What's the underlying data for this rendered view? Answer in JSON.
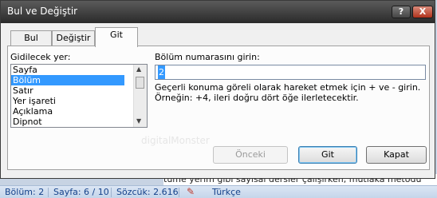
{
  "dialog": {
    "title": "Bul ve Değiştir",
    "help_label": "?",
    "close_label": "X",
    "tabs": [
      {
        "label": "Bul"
      },
      {
        "label": "Değiştir"
      },
      {
        "label": "Git",
        "active": true
      }
    ],
    "goto_label": "Gidilecek yer:",
    "goto_items": [
      {
        "label": "Sayfa"
      },
      {
        "label": "Bölüm",
        "selected": true
      },
      {
        "label": "Satır"
      },
      {
        "label": "Yer işareti"
      },
      {
        "label": "Açıklama"
      },
      {
        "label": "Dipnot"
      }
    ],
    "input_label": "Bölüm numarasını girin:",
    "input_value": "2",
    "help_text": "Geçerli konuma göreli olarak hareket etmek için + ve - girin. Örneğin: +4, ileri doğru dört öğe ilerletecektir.",
    "buttons": {
      "previous": "Önceki",
      "goto": "Git",
      "close": "Kapat"
    },
    "watermark": "digitalMonster"
  },
  "document": {
    "visible_text": "tume yerim gibi sayısal dersler çalışırken, mutlaka metodu"
  },
  "statusbar": {
    "section": "Bölüm: 2",
    "page": "Sayfa: 6 / 10",
    "words": "Sözcük: 2.616",
    "language": "Türkçe"
  },
  "colors": {
    "selection": "#3399ff",
    "statusbar_text": "#15428b"
  }
}
